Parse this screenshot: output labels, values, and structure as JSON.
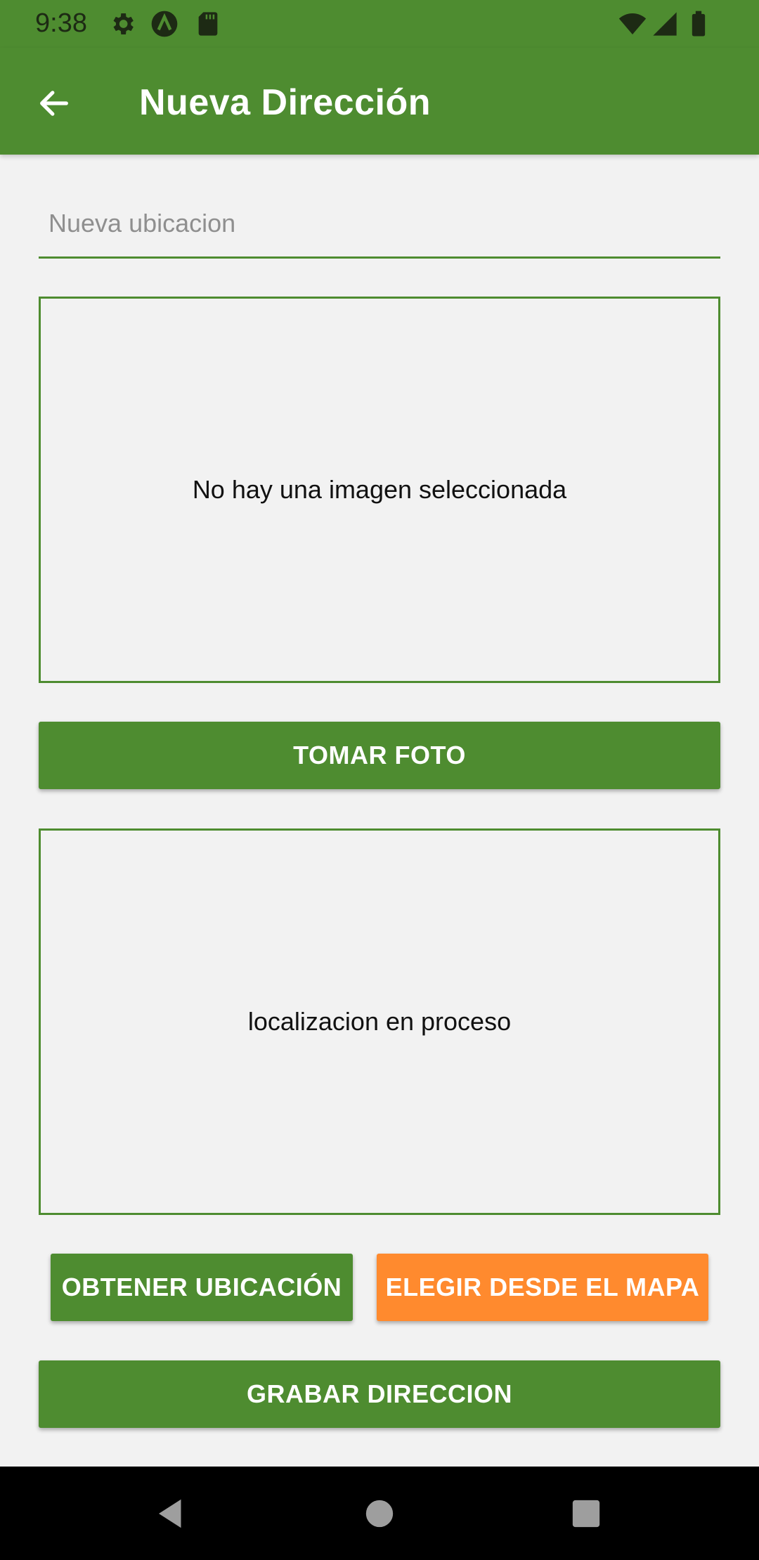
{
  "status_bar": {
    "time": "9:38",
    "icons": [
      "gear-icon",
      "app-a-icon",
      "sd-card-icon",
      "wifi-icon",
      "signal-icon",
      "battery-icon"
    ]
  },
  "app_bar": {
    "title": "Nueva Dirección",
    "back_icon": "arrow-left-icon"
  },
  "form": {
    "location_placeholder": "Nueva ubicacion",
    "location_value": ""
  },
  "image_box": {
    "text": "No hay una imagen seleccionada"
  },
  "take_photo_button": {
    "label": "TOMAR FOTO"
  },
  "map_box": {
    "text": "localizacion en proceso"
  },
  "get_location_button": {
    "label": "OBTENER UBICACIÓN"
  },
  "pick_from_map_button": {
    "label": "ELEGIR DESDE EL MAPA"
  },
  "save_button": {
    "label": "GRABAR DIRECCION"
  },
  "nav_bar": {
    "icons": [
      "back-triangle-icon",
      "home-circle-icon",
      "recents-square-icon"
    ]
  },
  "colors": {
    "primary": "#4e8c30",
    "accent": "#ff8a2e",
    "background": "#f2f2f2"
  }
}
